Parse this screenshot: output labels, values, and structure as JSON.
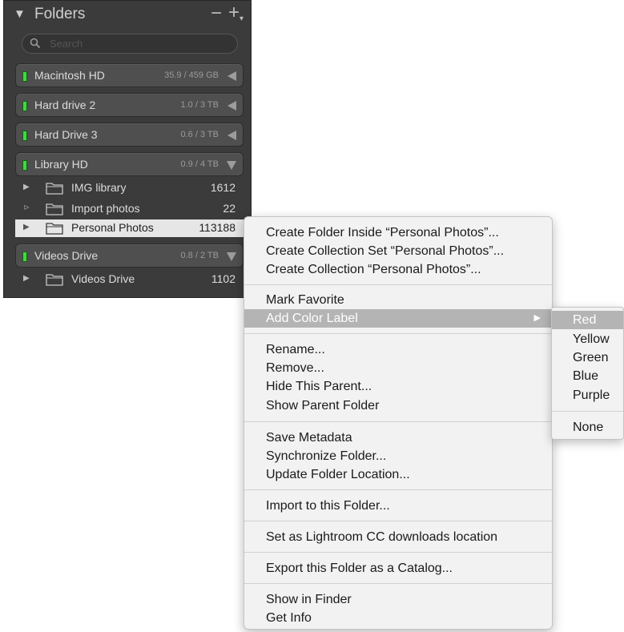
{
  "panel": {
    "title": "Folders",
    "minus_label": "−",
    "plus_label": "+",
    "search_placeholder": "Search",
    "volumes": [
      {
        "name": "Macintosh HD",
        "size": "35.9 / 459 GB",
        "expanded": false
      },
      {
        "name": "Hard drive 2",
        "size": "1.0 / 3 TB",
        "expanded": false
      },
      {
        "name": "Hard Drive 3",
        "size": "0.6 / 3 TB",
        "expanded": false
      },
      {
        "name": "Library HD",
        "size": "0.9 / 4 TB",
        "expanded": true
      },
      {
        "name": "Videos Drive",
        "size": "0.8 / 2 TB",
        "expanded": true
      }
    ],
    "folders": [
      {
        "name": "IMG library",
        "count": "1612",
        "selected": false
      },
      {
        "name": "Import photos",
        "count": "22",
        "selected": false
      },
      {
        "name": "Personal Photos",
        "count": "113188",
        "selected": true
      },
      {
        "name": "Videos Drive",
        "count": "1102",
        "selected": false
      }
    ]
  },
  "context_menu": {
    "items": [
      "Create Folder Inside “Personal Photos”...",
      "Create Collection Set “Personal Photos”...",
      "Create Collection “Personal Photos”...",
      "Mark Favorite",
      "Add Color Label",
      "Rename...",
      "Remove...",
      "Hide This Parent...",
      "Show Parent Folder",
      "Save Metadata",
      "Synchronize Folder...",
      "Update Folder Location...",
      "Import to this Folder...",
      "Set as Lightroom CC downloads location",
      "Export this Folder as a Catalog...",
      "Show in Finder",
      "Get Info"
    ],
    "highlighted": "Add Color Label",
    "submenu_arrow": "▶"
  },
  "color_label_submenu": {
    "items": [
      "Red",
      "Yellow",
      "Green",
      "Blue",
      "Purple",
      "None"
    ],
    "highlighted": "Red"
  },
  "colors": {
    "panel_bg": "#3b3b3b",
    "led_green": "#3cdc3c",
    "menu_bg": "#f2f2f2",
    "highlight": "#b4b4b4"
  }
}
